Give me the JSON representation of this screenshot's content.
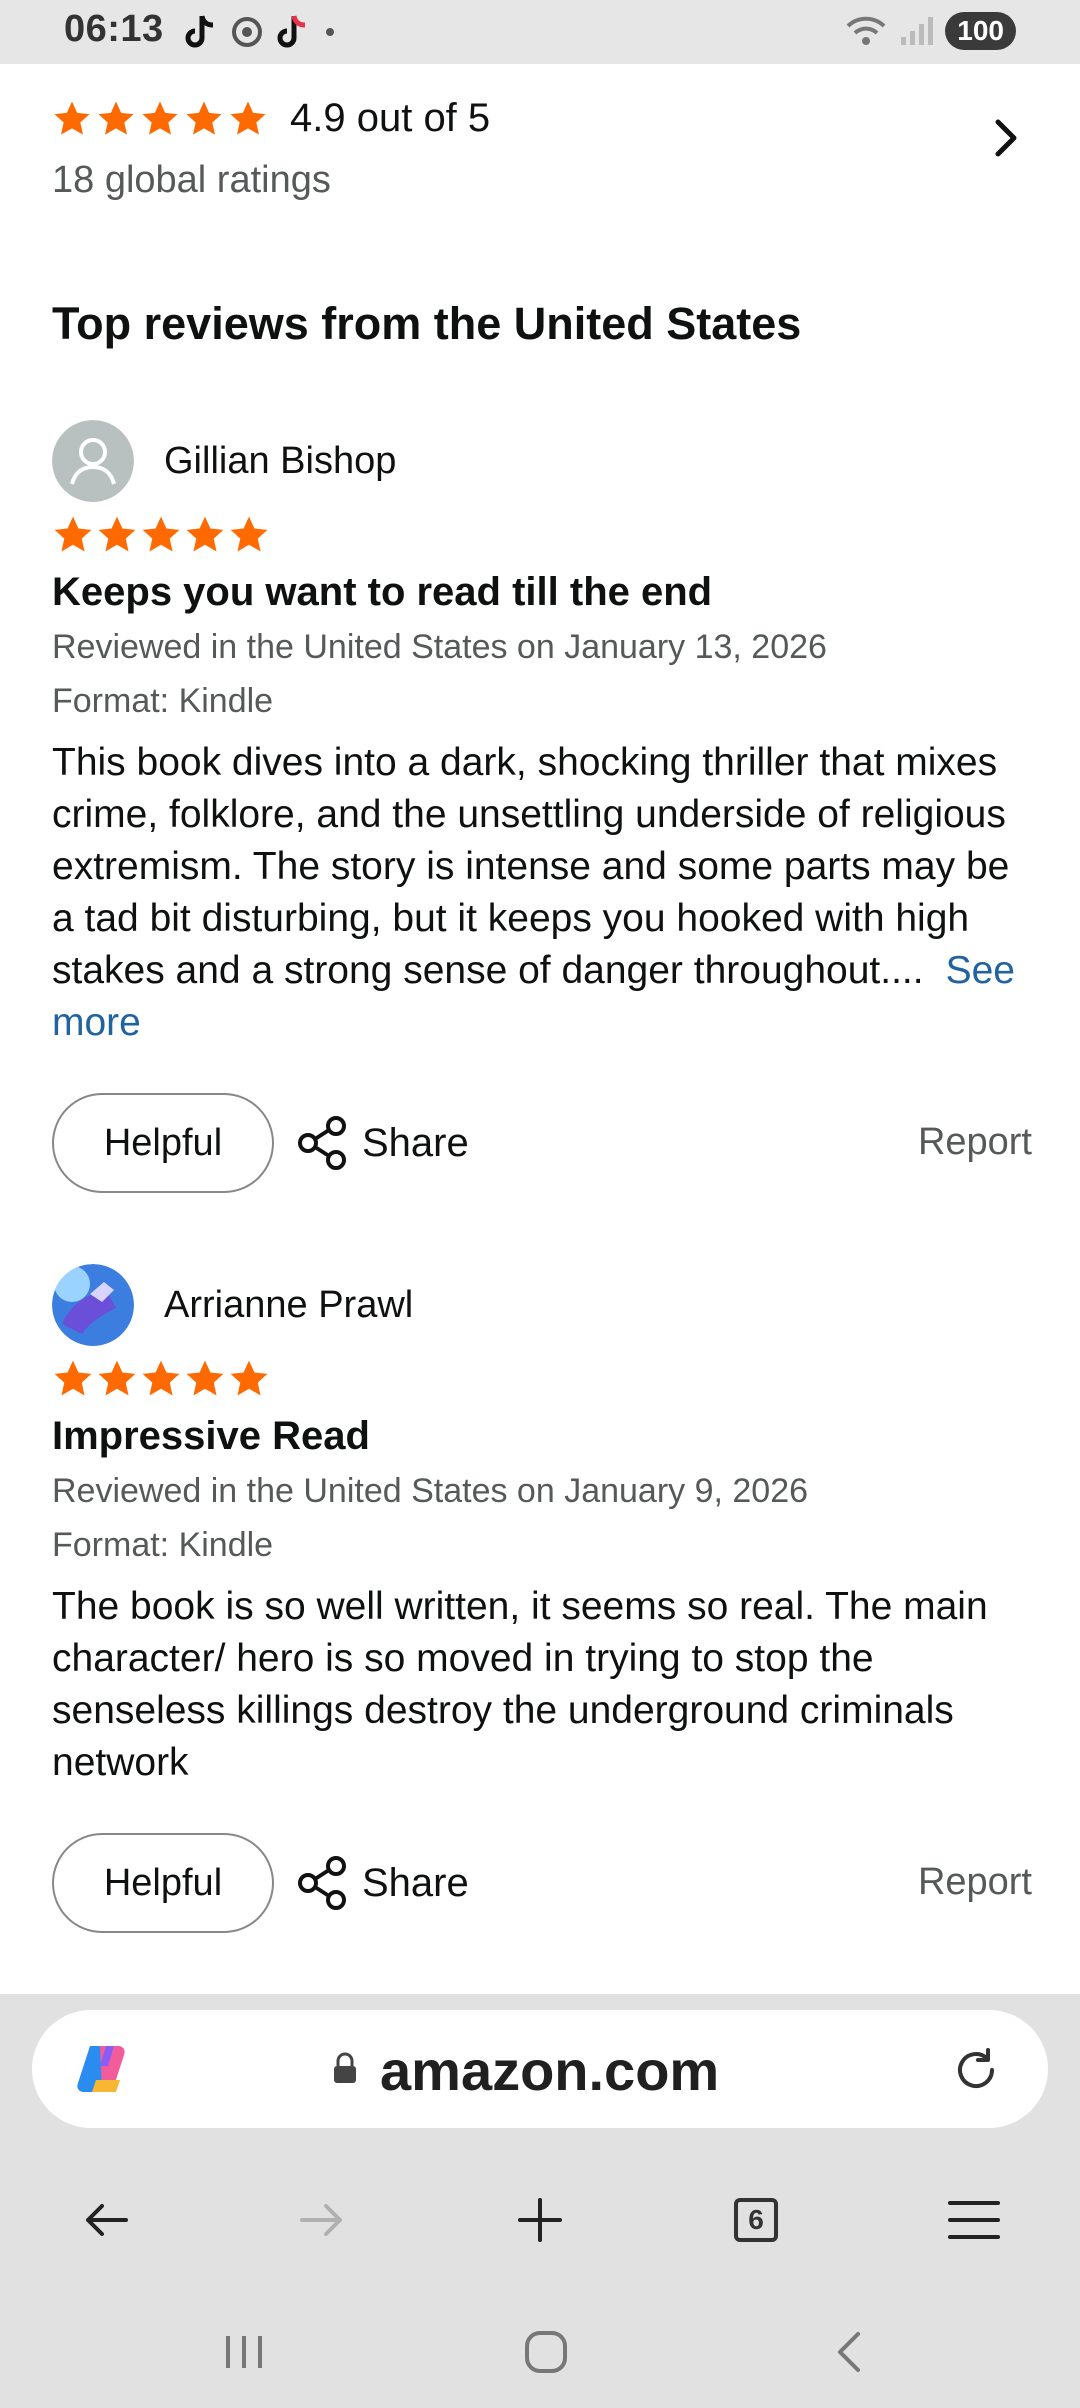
{
  "status_bar": {
    "time": "06:13",
    "battery": "100",
    "icons": [
      "tiktok-icon",
      "chrome-icon",
      "tiktok-icon",
      "dot-icon",
      "wifi-icon",
      "signal-icon"
    ]
  },
  "rating_summary": {
    "stars": 5,
    "rating_text": "4.9 out of 5",
    "global_ratings": "18 global ratings"
  },
  "section_title": "Top reviews from the United States",
  "reviews": [
    {
      "name": "Gillian Bishop",
      "stars": 5,
      "title": "Keeps you want to read till the end",
      "date": "Reviewed in the United States on January 13, 2026",
      "format": "Format: Kindle",
      "body": "This book dives into a dark, shocking thriller that mixes crime, folklore, and the unsettling underside of religious extremism. The story is intense and some parts may be a tad bit disturbing, but it keeps you hooked with high stakes and a strong sense of danger throughout....",
      "see_more": "See more",
      "helpful": "Helpful",
      "share": "Share",
      "report": "Report"
    },
    {
      "name": "Arrianne Prawl",
      "stars": 5,
      "title": "Impressive Read",
      "date": "Reviewed in the United States on January 9, 2026",
      "format": "Format: Kindle",
      "body": "The book is so well written, it seems so real. The main character/ hero is so moved in trying to stop the senseless killings destroy the underground criminals network",
      "helpful": "Helpful",
      "share": "Share",
      "report": "Report"
    }
  ],
  "browser": {
    "url": "amazon.com",
    "tab_count": "6"
  },
  "colors": {
    "star": "#ff6a00",
    "link": "#2162a1",
    "secondary_text": "#565959"
  }
}
